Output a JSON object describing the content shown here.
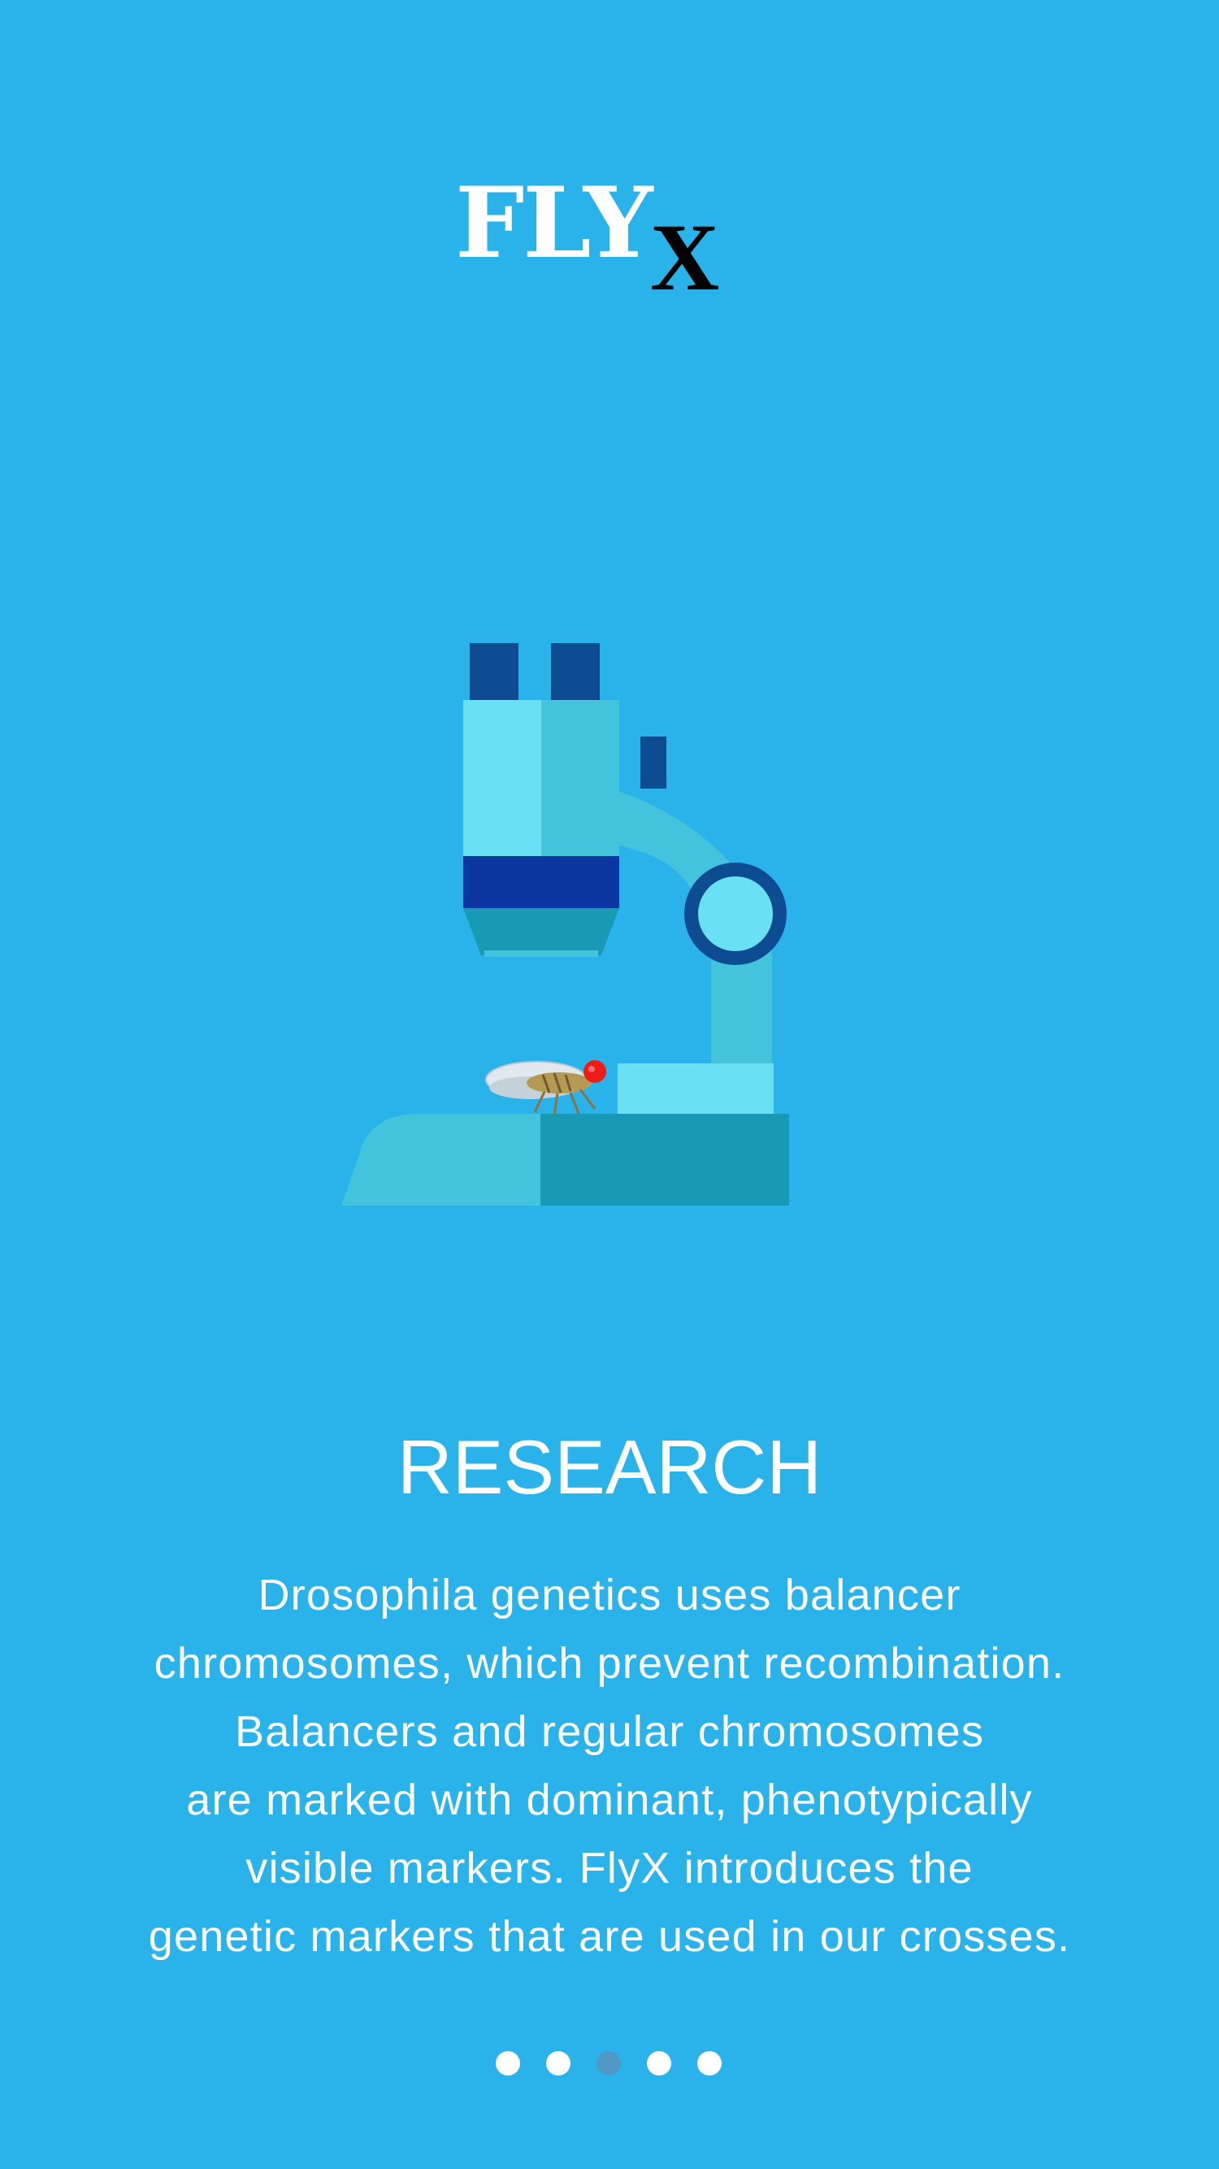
{
  "logo": {
    "main": "FLY",
    "sub": "X"
  },
  "illustration": {
    "icon_name": "microscope-icon",
    "specimen_icon_name": "fruit-fly-icon"
  },
  "slide": {
    "title": "RESEARCH",
    "body_lines": [
      "Drosophila genetics uses balancer",
      "chromosomes, which prevent recombination.",
      "Balancers and regular chromosomes",
      "are marked with dominant, phenotypically",
      "visible markers. FlyX introduces the",
      "genetic markers that are used in our crosses."
    ]
  },
  "pagination": {
    "total_pages": 5,
    "current_page": 3
  },
  "colors": {
    "background": "#29b3ea",
    "text": "#ffffff",
    "dot_inactive": "#ffffff",
    "dot_active": "#4f98c4",
    "microscope_light": "#6ae0f4",
    "microscope_mid": "#44c3dc",
    "microscope_dark": "#1899b4",
    "microscope_navy": "#0e4c92",
    "microscope_blue": "#0c37a0"
  }
}
